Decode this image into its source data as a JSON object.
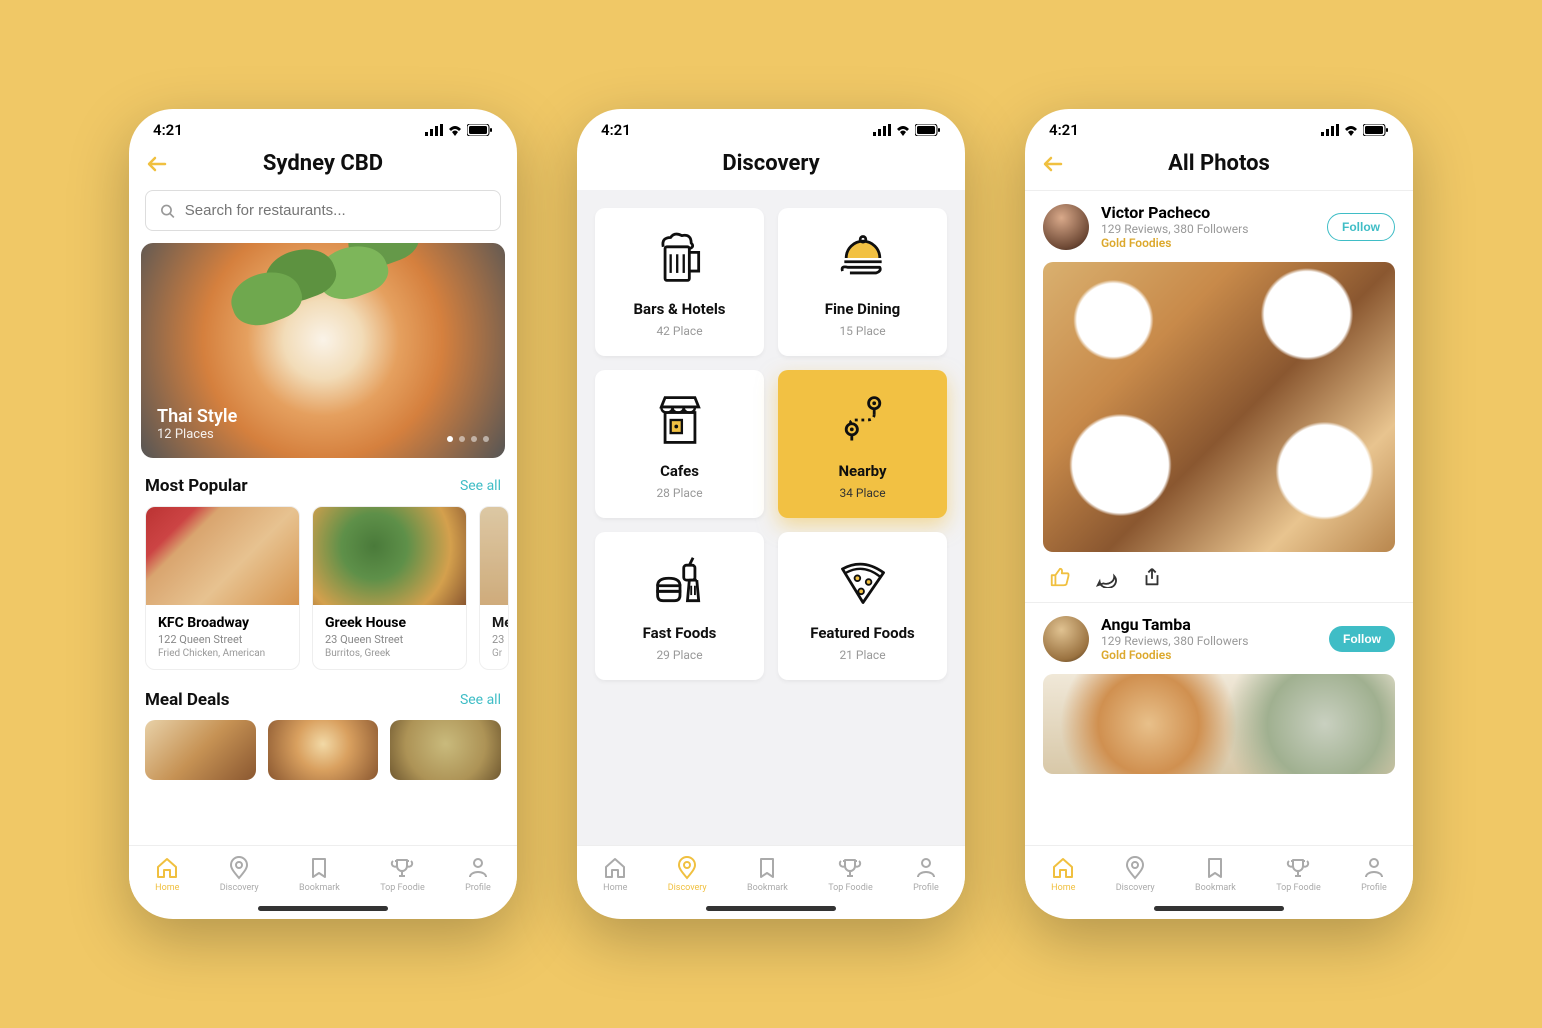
{
  "status": {
    "time": "4:21"
  },
  "nav": {
    "home": "Home",
    "discovery": "Discovery",
    "bookmark": "Bookmark",
    "topfoodie": "Top Foodie",
    "profile": "Profile"
  },
  "screen1": {
    "title": "Sydney CBD",
    "search_placeholder": "Search for restaurants...",
    "hero": {
      "title": "Thai Style",
      "sub": "12 Places"
    },
    "popular": {
      "title": "Most Popular",
      "see_all": "See all"
    },
    "popular_items": [
      {
        "name": "KFC Broadway",
        "addr": "122 Queen Street",
        "tags": "Fried Chicken, American"
      },
      {
        "name": "Greek House",
        "addr": "23 Queen Street",
        "tags": "Burritos, Greek"
      },
      {
        "name": "Me",
        "addr": "23",
        "tags": "Gr"
      }
    ],
    "meal_deals": {
      "title": "Meal Deals",
      "see_all": "See all"
    }
  },
  "screen2": {
    "title": "Discovery",
    "categories": [
      {
        "title": "Bars  & Hotels",
        "sub": "42 Place",
        "active": false
      },
      {
        "title": "Fine Dining",
        "sub": "15 Place",
        "active": false
      },
      {
        "title": "Cafes",
        "sub": "28 Place",
        "active": false
      },
      {
        "title": "Nearby",
        "sub": "34 Place",
        "active": true
      },
      {
        "title": "Fast Foods",
        "sub": "29 Place",
        "active": false
      },
      {
        "title": "Featured Foods",
        "sub": "21 Place",
        "active": false
      }
    ]
  },
  "screen3": {
    "title": "All Photos",
    "users": [
      {
        "name": "Victor Pacheco",
        "stats": "129 Reviews, 380 Followers",
        "badge": "Gold Foodies",
        "follow": "Follow",
        "filled": false
      },
      {
        "name": "Angu Tamba",
        "stats": "129 Reviews, 380 Followers",
        "badge": "Gold Foodies",
        "follow": "Follow",
        "filled": true
      }
    ]
  }
}
